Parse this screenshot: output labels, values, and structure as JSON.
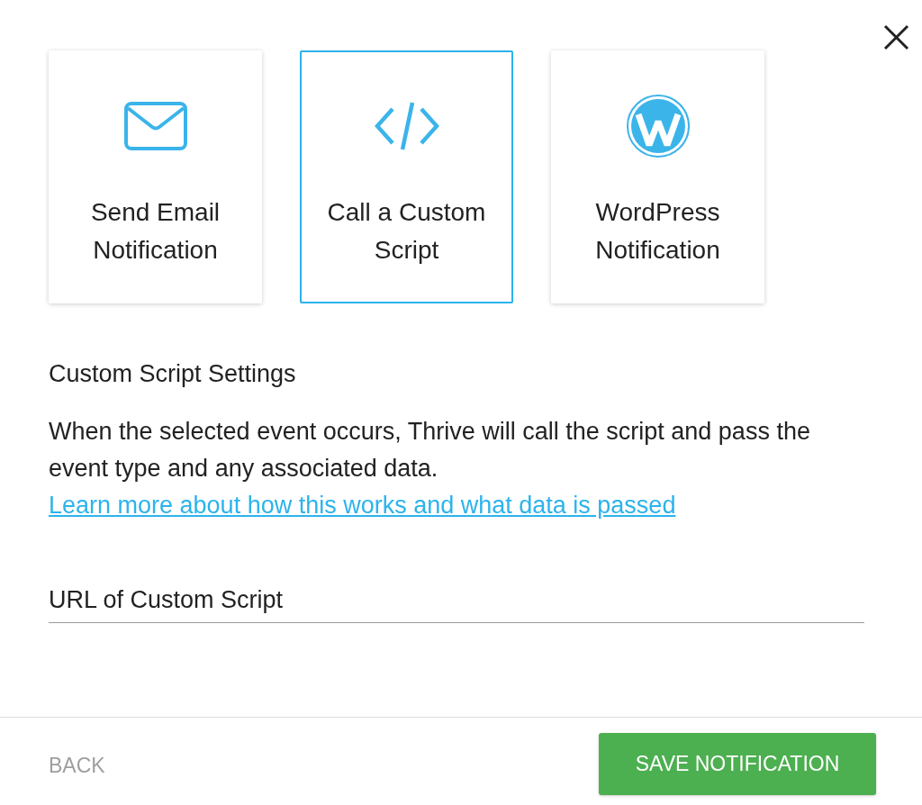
{
  "cards": [
    {
      "kind": "email",
      "label": "Send Email Notification",
      "selected": false
    },
    {
      "kind": "code",
      "label": "Call a Custom Script",
      "selected": true
    },
    {
      "kind": "wordpress",
      "label": "WordPress Notification",
      "selected": false
    }
  ],
  "settings": {
    "title": "Custom Script Settings",
    "description": "When the selected event occurs, Thrive will call the script and pass the event type and any associated data.",
    "link": "Learn more about how this works and what data is passed"
  },
  "url_field": {
    "placeholder": "URL of Custom Script"
  },
  "footer": {
    "back_button": "BACK",
    "save_button": "SAVE NOTIFICATION"
  }
}
